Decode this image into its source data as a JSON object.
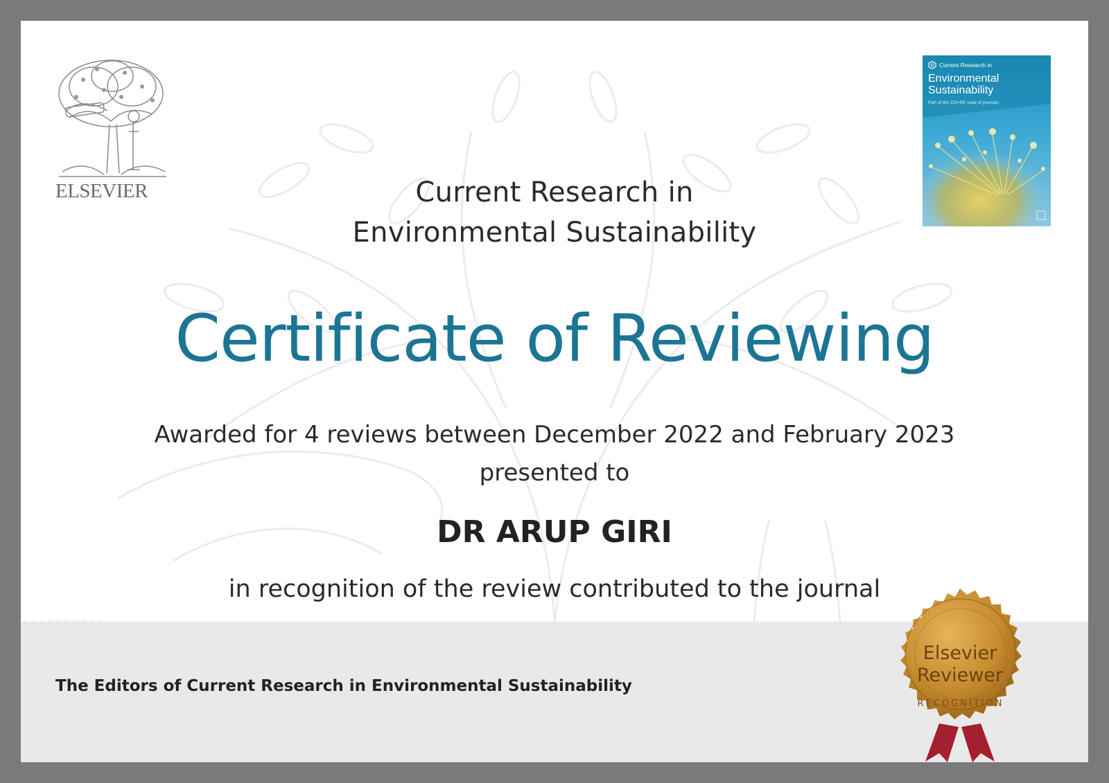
{
  "publisher": {
    "name": "ELSEVIER"
  },
  "cover": {
    "series": "Current Research in",
    "title": "Environmental Sustainability",
    "subtitle": "Part of the CO+RE suite of journals"
  },
  "journal": {
    "line1": "Current Research in",
    "line2": "Environmental Sustainability"
  },
  "certificate": {
    "title": "Certificate of Reviewing",
    "awarded_text": "Awarded for 4 reviews between December 2022 and February 2023",
    "presented_text": "presented to",
    "recipient": "DR ARUP GIRI",
    "recognition_text": "in recognition of the review contributed to the journal"
  },
  "footer": {
    "editors": "The Editors of Current Research in Environmental Sustainability"
  },
  "seal": {
    "line1": "Elsevier",
    "line2": "Reviewer",
    "arc_text": "RECOGNITION"
  },
  "colors": {
    "frame": "#7a7a7a",
    "title_accent": "#1c7594",
    "seal_gold": "#c68b2e",
    "ribbon": "#a5202e"
  }
}
